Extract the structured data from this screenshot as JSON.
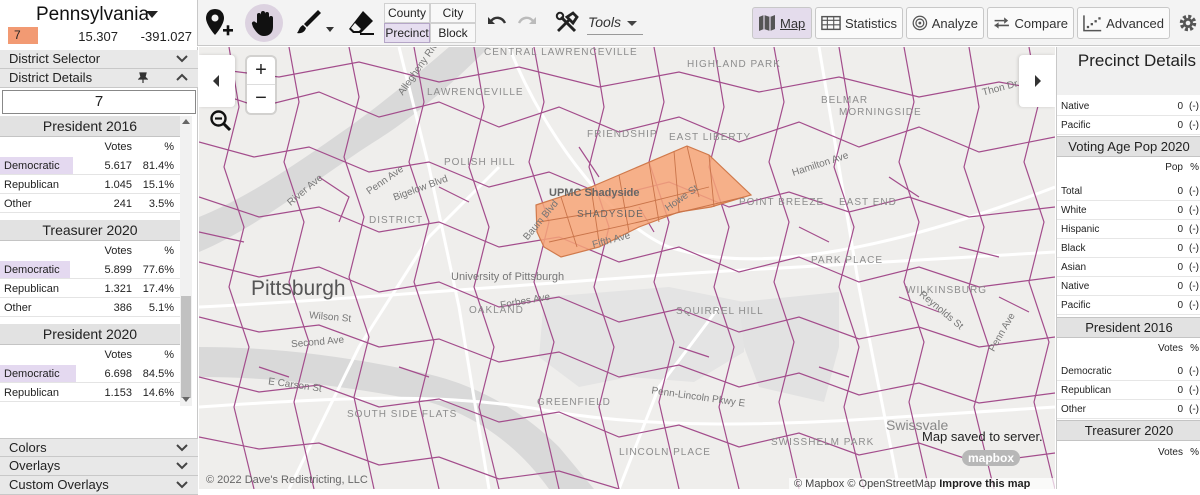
{
  "header": {
    "state": "Pennsylvania",
    "district_chip": "7",
    "coord_x": "15.307",
    "coord_y": "-391.027",
    "district_color": "#f29a73"
  },
  "toolbar": {
    "granularity": {
      "county": "County",
      "city": "City",
      "precinct": "Precinct",
      "block": "Block",
      "active": "Precinct"
    },
    "tools_label": "Tools",
    "nav": {
      "map": "Map",
      "statistics": "Statistics",
      "analyze": "Analyze",
      "compare": "Compare",
      "advanced": "Advanced",
      "active": "Map"
    },
    "icons": [
      "add-marker-icon",
      "hand-pan-icon",
      "paintbrush-icon",
      "eraser-icon",
      "undo-icon",
      "redo-icon",
      "tools-icon",
      "map-icon",
      "table-icon",
      "target-icon",
      "compare-icon",
      "chart-icon",
      "gear-icon"
    ]
  },
  "left_panel": {
    "district_selector": "District Selector",
    "district_details": "District Details",
    "district_number": "7",
    "votes_label": "Votes",
    "pct_label": "%",
    "sections": [
      {
        "title": "President 2016",
        "rows": [
          {
            "label": "Democratic",
            "votes": "5.617",
            "pct": "81.4%",
            "share": 0.814
          },
          {
            "label": "Republican",
            "votes": "1.045",
            "pct": "15.1%",
            "share": 0
          },
          {
            "label": "Other",
            "votes": "241",
            "pct": "3.5%",
            "share": 0
          }
        ]
      },
      {
        "title": "Treasurer 2020",
        "rows": [
          {
            "label": "Democratic",
            "votes": "5.899",
            "pct": "77.6%",
            "share": 0.776
          },
          {
            "label": "Republican",
            "votes": "1.321",
            "pct": "17.4%",
            "share": 0
          },
          {
            "label": "Other",
            "votes": "386",
            "pct": "5.1%",
            "share": 0
          }
        ]
      },
      {
        "title": "President 2020",
        "rows": [
          {
            "label": "Democratic",
            "votes": "6.698",
            "pct": "84.5%",
            "share": 0.845
          },
          {
            "label": "Republican",
            "votes": "1.153",
            "pct": "14.6%",
            "share": 0
          }
        ]
      }
    ],
    "colors": "Colors",
    "overlays": "Overlays",
    "custom_overlays": "Custom Overlays"
  },
  "map": {
    "city": "Pittsburgh",
    "saved_message": "Map saved to server.",
    "mapbox": "mapbox",
    "copyright": "© 2022 Dave's Redistricting, LLC",
    "attribution_a": "© Mapbox © OpenStreetMap",
    "attribution_b": "Improve this map",
    "zoom_in": "+",
    "zoom_out": "−",
    "selected_fill": "#f7a578",
    "line_color": "#a34d8c",
    "area_labels": [
      "CENTRAL LAWRENCEVILLE",
      "LAWRENCEVILLE",
      "FRIENDSHIP",
      "UPMC Shadyside",
      "SHADYSIDE",
      "EAST LIBERTY",
      "POINT BREEZE",
      "EAST END",
      "PARK PLACE",
      "WILKINSBURG",
      "SQUIRREL HILL",
      "University of Pittsburgh",
      "OAKLAND",
      "SOUTH SIDE FLATS",
      "GREENFIELD",
      "Swissvale",
      "SWISSHELM PARK",
      "LINCOLN PLACE",
      "HIGHLAND PARK",
      "BELMAR",
      "DISTRICT",
      "POLISH HILL",
      "MORNINGSIDE"
    ],
    "road_labels": [
      "River Ave",
      "Penn Ave",
      "Bigelow Blvd",
      "Second Ave",
      "E Carson St",
      "Forbes Ave",
      "Hamilton Ave",
      "Penn-Lincoln Pkwy E",
      "Penn Ave",
      "Fifth Ave",
      "Howe St",
      "Baum Blvd",
      "Allegheny River Blvd",
      "Thon Dr",
      "Reynolds St",
      "Wilson St"
    ]
  },
  "right_panel": {
    "title": "Precinct Details",
    "top_rows": [
      {
        "label": "Native",
        "value": "0",
        "pct": "(-)"
      },
      {
        "label": "Pacific",
        "value": "0",
        "pct": "(-)"
      }
    ],
    "vap_title": "Voting Age Pop 2020",
    "pop_label": "Pop",
    "pct_label": "%",
    "vap_rows": [
      {
        "label": "Total",
        "value": "0",
        "pct": "(-)"
      },
      {
        "label": "White",
        "value": "0",
        "pct": "(-)"
      },
      {
        "label": "Hispanic",
        "value": "0",
        "pct": "(-)"
      },
      {
        "label": "Black",
        "value": "0",
        "pct": "(-)"
      },
      {
        "label": "Asian",
        "value": "0",
        "pct": "(-)"
      },
      {
        "label": "Native",
        "value": "0",
        "pct": "(-)"
      },
      {
        "label": "Pacific",
        "value": "0",
        "pct": "(-)"
      }
    ],
    "pres_title": "President 2016",
    "votes_label": "Votes",
    "pres_rows": [
      {
        "label": "Democratic",
        "value": "0",
        "pct": "(-)"
      },
      {
        "label": "Republican",
        "value": "0",
        "pct": "(-)"
      },
      {
        "label": "Other",
        "value": "0",
        "pct": "(-)"
      }
    ],
    "treas_title": "Treasurer 2020"
  }
}
